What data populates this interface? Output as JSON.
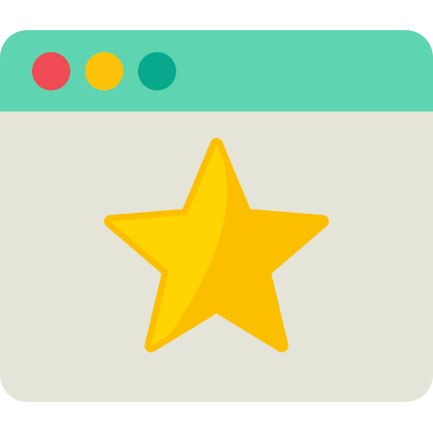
{
  "icon": {
    "name": "favorites-window-icon",
    "colors": {
      "titlebar": "#5fd4b0",
      "body": "#e4e4d9",
      "close_dot": "#f04a54",
      "minimize_dot": "#fcc20a",
      "maximize_dot": "#08a88d",
      "star_light": "#ffd400",
      "star_dark": "#fcbf00"
    },
    "window_controls": [
      "close-dot",
      "minimize-dot",
      "maximize-dot"
    ],
    "symbol": "star-icon"
  }
}
